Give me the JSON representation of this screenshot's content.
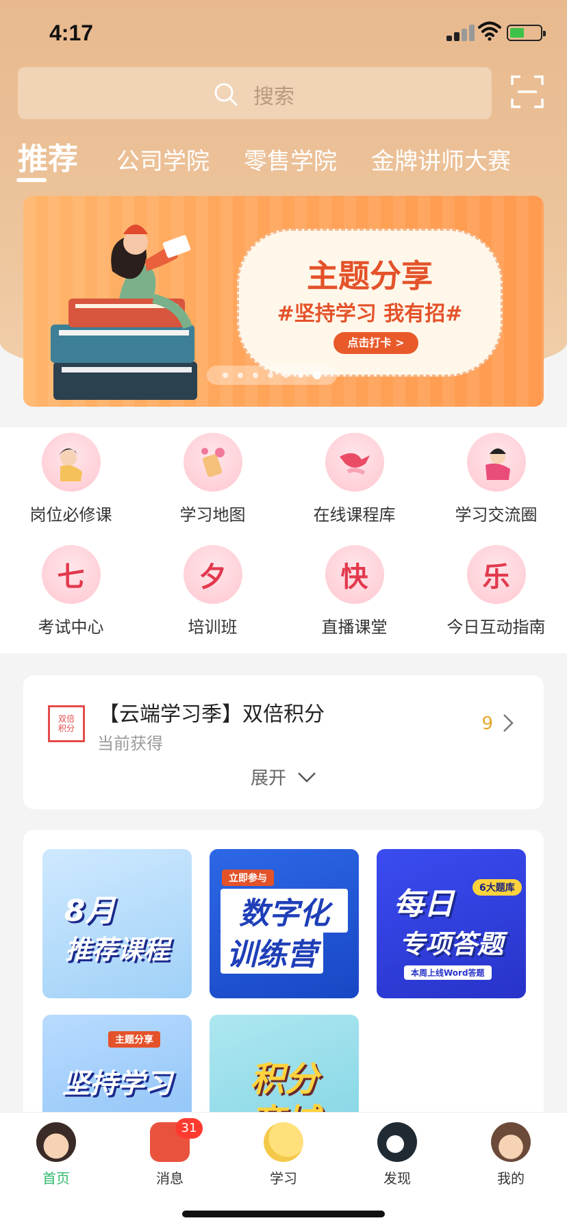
{
  "status_bar": {
    "time": "4:17"
  },
  "search": {
    "placeholder": "搜索"
  },
  "tabs": [
    {
      "label": "推荐",
      "active": true
    },
    {
      "label": "公司学院"
    },
    {
      "label": "零售学院"
    },
    {
      "label": "金牌讲师大赛"
    }
  ],
  "banner": {
    "title": "主题分享",
    "subtitle": "#坚持学习 我有招#",
    "button": "点击打卡 >",
    "page_count": 7,
    "active_page": 7
  },
  "grid": {
    "items": [
      {
        "label": "岗位必修课",
        "icon": "girl-portrait-icon",
        "glyph": ""
      },
      {
        "label": "学习地图",
        "icon": "tag-flower-icon",
        "glyph": ""
      },
      {
        "label": "在线课程库",
        "icon": "magpie-icon",
        "glyph": ""
      },
      {
        "label": "学习交流圈",
        "icon": "fairy-icon",
        "glyph": ""
      },
      {
        "label": "考试中心",
        "icon": "char-qi-icon",
        "glyph": "七"
      },
      {
        "label": "培训班",
        "icon": "char-xi-icon",
        "glyph": "夕"
      },
      {
        "label": "直播课堂",
        "icon": "char-kuai-icon",
        "glyph": "快"
      },
      {
        "label": "今日互动指南",
        "icon": "char-le-icon",
        "glyph": "乐"
      }
    ]
  },
  "points_card": {
    "icon_text": [
      "双倍",
      "积分"
    ],
    "title": "【云端学习季】双倍积分",
    "subtitle": "当前获得",
    "value": "9",
    "expand_label": "展开"
  },
  "courses": [
    {
      "line1": "8月",
      "line2": "推荐课程"
    },
    {
      "badge": "立即参与",
      "line1": "数字化",
      "line2": "训练营"
    },
    {
      "line1": "每日",
      "line2": "专项答题",
      "badge": "6大题库",
      "caption": "本周上线Word答题"
    },
    {
      "badge": "主题分享",
      "line1": "坚持学习"
    },
    {
      "line1": "积分",
      "line2": "商城"
    }
  ],
  "tabbar": {
    "items": [
      {
        "label": "首页",
        "icon": "home-girl-icon",
        "active": true
      },
      {
        "label": "消息",
        "icon": "message-robot-icon",
        "badge": "31"
      },
      {
        "label": "学习",
        "icon": "moon-icon"
      },
      {
        "label": "发现",
        "icon": "penguin-icon"
      },
      {
        "label": "我的",
        "icon": "profile-boy-icon"
      }
    ]
  },
  "colors": {
    "header_bg": "#e8b98e",
    "accent": "#e4522a",
    "active_tab": "#2fb86a",
    "badge": "#ff3b30",
    "points_value": "#e6a82a"
  }
}
